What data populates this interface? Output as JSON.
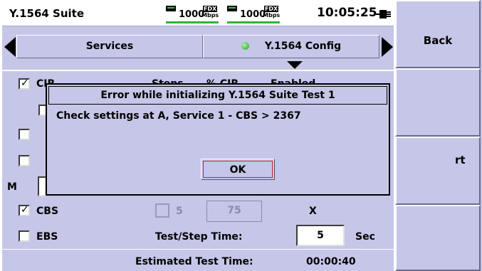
{
  "status": {
    "app_title": "Y.1564 Suite",
    "link_a": {
      "speed": "1000",
      "duplex": "FDX",
      "unit": "Mbps"
    },
    "link_b": {
      "speed": "1000",
      "duplex": "FDX",
      "unit": "Mbps"
    },
    "clock": "10:05:25",
    "power_icon": "plug-icon"
  },
  "side": {
    "back_label": "Back",
    "start_fragment": "rt"
  },
  "tabs": {
    "services_label": "Services",
    "config_label": "Y.1564 Config"
  },
  "rows": {
    "cir_label": "CIR",
    "steps_header": "Steps",
    "pct_cir_header": "% CIR",
    "enabled_header": "Enabled",
    "m_label": "M",
    "cbs_label": "CBS",
    "cbs_step": "5",
    "cbs_value": "75",
    "cbs_x": "X",
    "ebs_label": "EBS",
    "step_time_label": "Test/Step Time:",
    "step_time_value": "5",
    "step_time_unit": "Sec",
    "est_label": "Estimated Test Time:",
    "est_value": "00:00:40"
  },
  "dialog": {
    "title": "Error while initializing Y.1564 Suite Test 1",
    "message": "Check settings at A, Service 1 - CBS > 2367",
    "ok_label": "OK"
  },
  "colors": {
    "panel_bg": "#c6c6e8",
    "link_green": "#31b33a",
    "ok_focus": "#d02030"
  }
}
